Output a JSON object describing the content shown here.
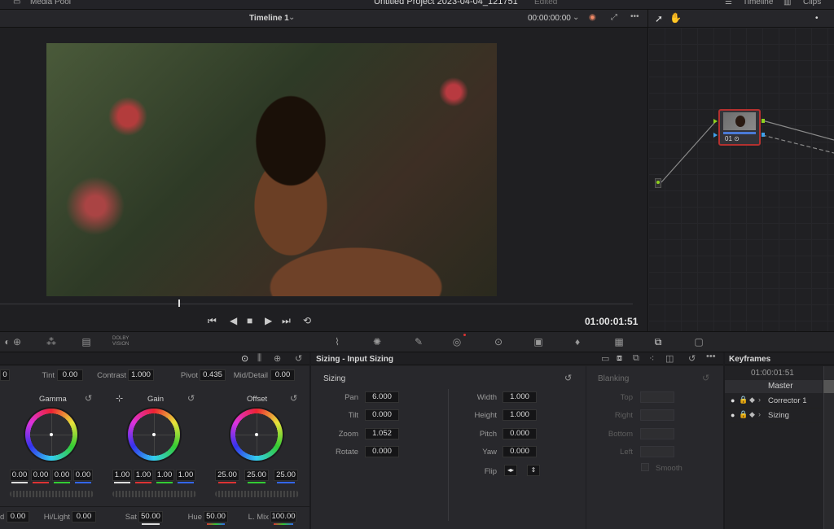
{
  "topbar": {
    "media_pool": "Media Pool",
    "project_title": "Untitled Project 2023-04-04_121751",
    "project_status": "Edited",
    "timeline_btn": "Timeline",
    "clips_btn": "Clips"
  },
  "viewer": {
    "timeline_name": "Timeline 1",
    "source_timecode": "00:00:00:00",
    "record_timecode": "01:00:01:51"
  },
  "toolbar": {
    "dolby_line1": "DOLBY",
    "dolby_line2": "VISION"
  },
  "primaries": {
    "tint_label": "Tint",
    "tint_value": "0.00",
    "contrast_label": "Contrast",
    "contrast_value": "1.000",
    "pivot_label": "Pivot",
    "pivot_value": "0.435",
    "middetail_label": "Mid/Detail",
    "middetail_value": "0.00",
    "left_value": "0",
    "wheels": [
      {
        "name": "Gamma",
        "values": [
          "0.00",
          "0.00",
          "0.00",
          "0.00"
        ]
      },
      {
        "name": "Gain",
        "values": [
          "1.00",
          "1.00",
          "1.00",
          "1.00"
        ]
      },
      {
        "name": "Offset",
        "values": [
          "25.00",
          "25.00",
          "25.00"
        ]
      }
    ],
    "bottom": {
      "d_label": "d",
      "d_value": "0.00",
      "hilight_label": "Hi/Light",
      "hilight_value": "0.00",
      "sat_label": "Sat",
      "sat_value": "50.00",
      "hue_label": "Hue",
      "hue_value": "50.00",
      "lmix_label": "L. Mix",
      "lmix_value": "100.00"
    }
  },
  "sizing": {
    "panel_title": "Sizing - Input Sizing",
    "section": "Sizing",
    "pan_label": "Pan",
    "pan_value": "6.000",
    "tilt_label": "Tilt",
    "tilt_value": "0.000",
    "zoom_label": "Zoom",
    "zoom_value": "1.052",
    "rotate_label": "Rotate",
    "rotate_value": "0.000",
    "width_label": "Width",
    "width_value": "1.000",
    "height_label": "Height",
    "height_value": "1.000",
    "pitch_label": "Pitch",
    "pitch_value": "0.000",
    "yaw_label": "Yaw",
    "yaw_value": "0.000",
    "flip_label": "Flip",
    "blanking": "Blanking",
    "top_label": "Top",
    "right_label": "Right",
    "bottom_label": "Bottom",
    "left_label": "Left",
    "smooth_label": "Smooth"
  },
  "keyframes": {
    "title": "Keyframes",
    "timecode": "01:00:01:51",
    "master": "Master",
    "rows": [
      "Corrector 1",
      "Sizing"
    ]
  },
  "node": {
    "label": "01"
  },
  "colors": {
    "accent_red": "#b3312f",
    "accent_blue": "#4a7ad6",
    "node_green": "#8fd11f"
  }
}
